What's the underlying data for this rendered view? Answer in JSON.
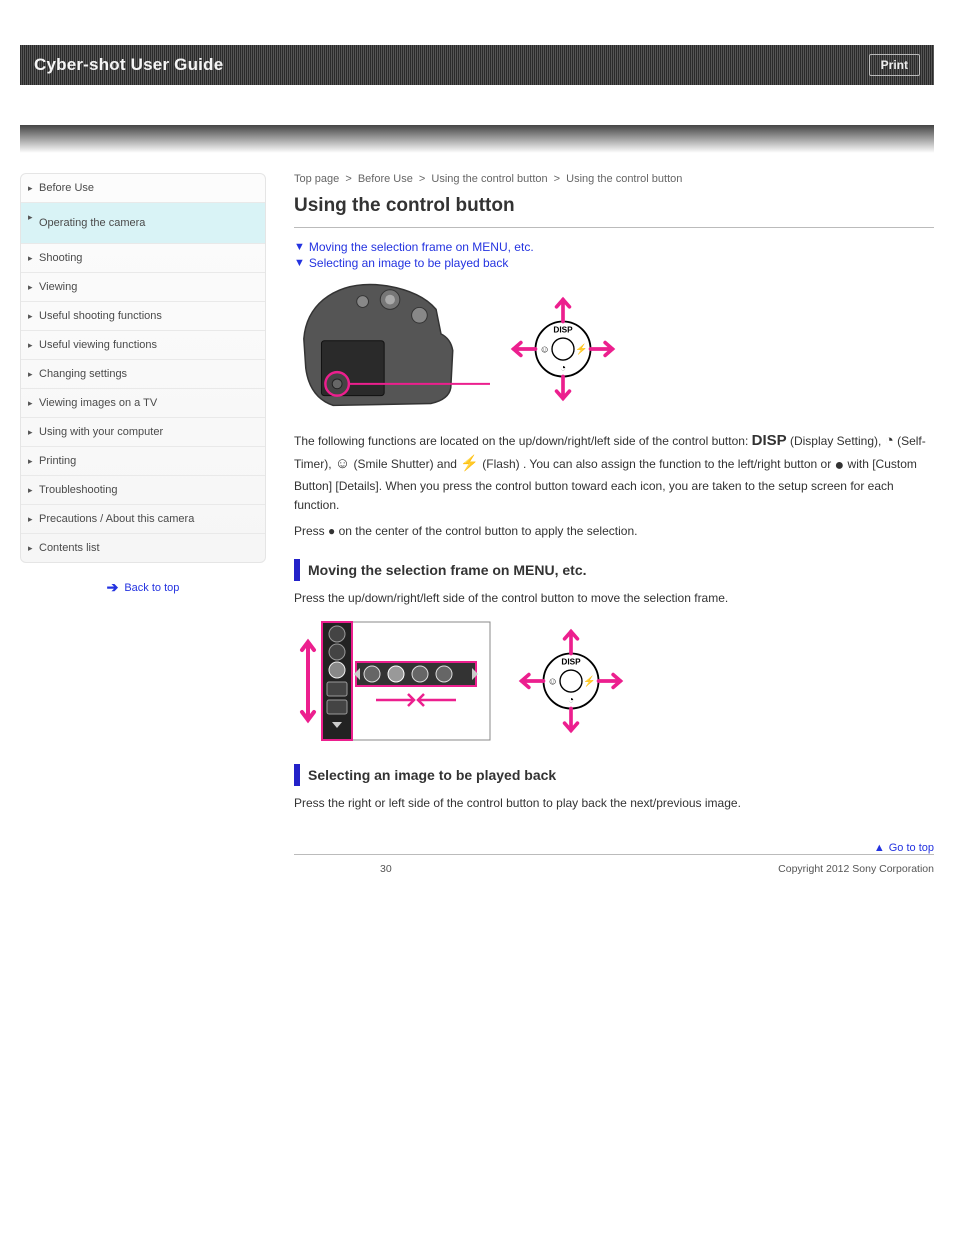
{
  "header": {
    "title": "Cyber-shot User Guide",
    "badge": "Print"
  },
  "breadcrumb": {
    "a": "Top page",
    "b": "Before Use",
    "c": "Using the control button",
    "d": "Using the control button"
  },
  "sidebar": {
    "items": [
      {
        "label": "Before Use"
      },
      {
        "label": "Operating the camera"
      },
      {
        "label": "Shooting"
      },
      {
        "label": "Viewing"
      },
      {
        "label": "Useful shooting functions"
      },
      {
        "label": "Useful viewing functions"
      },
      {
        "label": "Changing settings"
      },
      {
        "label": "Viewing images on a TV"
      },
      {
        "label": "Using with your computer"
      },
      {
        "label": "Printing"
      },
      {
        "label": "Troubleshooting"
      },
      {
        "label": "Precautions / About this camera"
      },
      {
        "label": "Contents list"
      }
    ],
    "active_index": 1,
    "back": "Back to top"
  },
  "page": {
    "title": "Using the control button",
    "sublinks": [
      "Moving the selection frame on MENU, etc.",
      "Selecting an image to be played back"
    ],
    "dial_labels": {
      "disp": {
        "icon": "DISP",
        "text": " (Display Setting)"
      },
      "timer": {
        "icon": "◔",
        "text": " (Self-Timer)"
      },
      "smile": {
        "icon": "☺",
        "text": " (Smile Shutter)"
      },
      "flash": {
        "icon": "⚡",
        "text": " (Flash)"
      }
    },
    "para1_pre": "The following functions are located on the up/down/right/left side of the control button: ",
    "para1_post": ". You can also assign the function to the left/right button or ",
    "para1_link": " with [Custom Button] [Details]. When you press the control button toward each icon, you are taken to the setup screen for each function.",
    "para2": "Press ● on the center of the control button to apply the selection.",
    "section1": "Moving the selection frame on MENU, etc.",
    "section1_body": "Press the up/down/right/left side of the control button to move the selection frame.",
    "section2": "Selecting an image to be played back",
    "section2_body": "Press the right or left side of the control button to play back the next/previous image."
  },
  "footer": {
    "goto_top": "Go to top",
    "copyright": "Copyright 2012 Sony Corporation",
    "page_number": "30"
  }
}
